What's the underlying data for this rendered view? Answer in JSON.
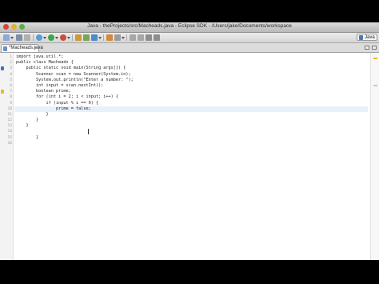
{
  "window": {
    "title": "Java - theProjects/src/Macheads.java - Eclipse SDK - /Users/jake/Documents/workspace"
  },
  "perspective": {
    "label": "Java"
  },
  "editor_tab": {
    "label": "*Macheads.java",
    "close": "×"
  },
  "code_lines": [
    {
      "num": "1",
      "text": "import java.util.*;"
    },
    {
      "num": "2",
      "text": "public class Macheads {"
    },
    {
      "num": "3",
      "text": "    public static void main(String args[]) {"
    },
    {
      "num": "4",
      "text": "        Scanner scan = new Scanner(System.in);"
    },
    {
      "num": "5",
      "text": "        System.out.println(\"Enter a number: \");"
    },
    {
      "num": "6",
      "text": "        int input = scan.nextInt();"
    },
    {
      "num": "7",
      "text": "        boolean prime;"
    },
    {
      "num": "8",
      "text": "        for (int i = 2; i < input; i++) {"
    },
    {
      "num": "9",
      "text": "            if (input % i == 0) {"
    },
    {
      "num": "10",
      "text": "                prime = false;"
    },
    {
      "num": "11",
      "text": "            }"
    },
    {
      "num": "12",
      "text": "        }"
    },
    {
      "num": "13",
      "text": "    }"
    },
    {
      "num": "14",
      "text": ""
    },
    {
      "num": "15",
      "text": "        }"
    },
    {
      "num": "16",
      "text": ""
    }
  ],
  "colors": {
    "warning_marker": "#e8b72c",
    "info_marker": "#3c73c9",
    "current_line": "#e8f0fb"
  }
}
